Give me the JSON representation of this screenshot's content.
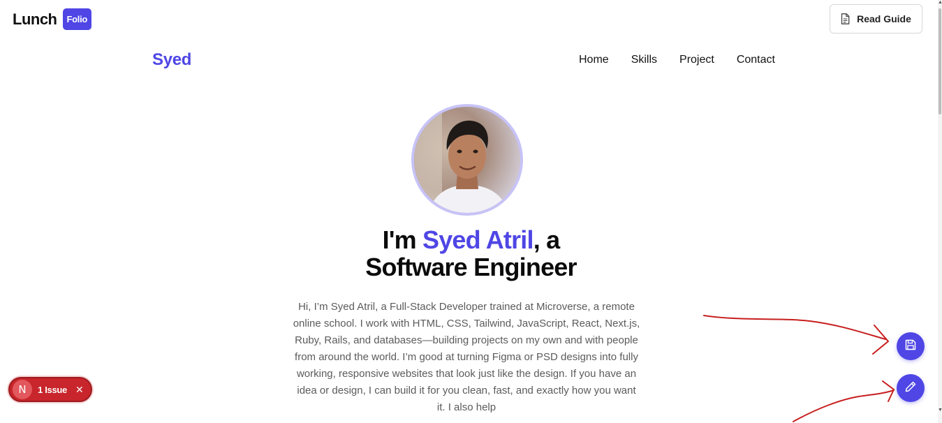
{
  "app": {
    "logo_word": "Lunch",
    "logo_badge": "Folio",
    "guide_button_label": "Read Guide",
    "guide_icon": "document-icon"
  },
  "site": {
    "brand": "Syed",
    "nav": [
      "Home",
      "Skills",
      "Project",
      "Contact"
    ]
  },
  "hero": {
    "headline_prefix": "I'm ",
    "headline_name": "Syed Atril",
    "headline_suffix": ", a",
    "headline_line2": "Software Engineer",
    "bio": "Hi, I’m Syed Atril, a Full-Stack Developer trained at Microverse, a remote online school. I work with HTML, CSS, Tailwind, JavaScript, React, Next.js, Ruby, Rails, and databases—building projects on my own and with people from around the world. I’m good at turning Figma or PSD designs into fully working, responsive websites that look just like the design. If you have an idea or design, I can build it for you clean, fast, and exactly how you want it. I also help"
  },
  "fabs": {
    "save_icon": "save-icon",
    "edit_icon": "pencil-icon"
  },
  "issue_badge": {
    "letter": "N",
    "label": "1 Issue",
    "close": "✕"
  },
  "colors": {
    "accent": "#4f46e5",
    "issue_red": "#c8262c",
    "annotation_red": "#c81e1e"
  }
}
